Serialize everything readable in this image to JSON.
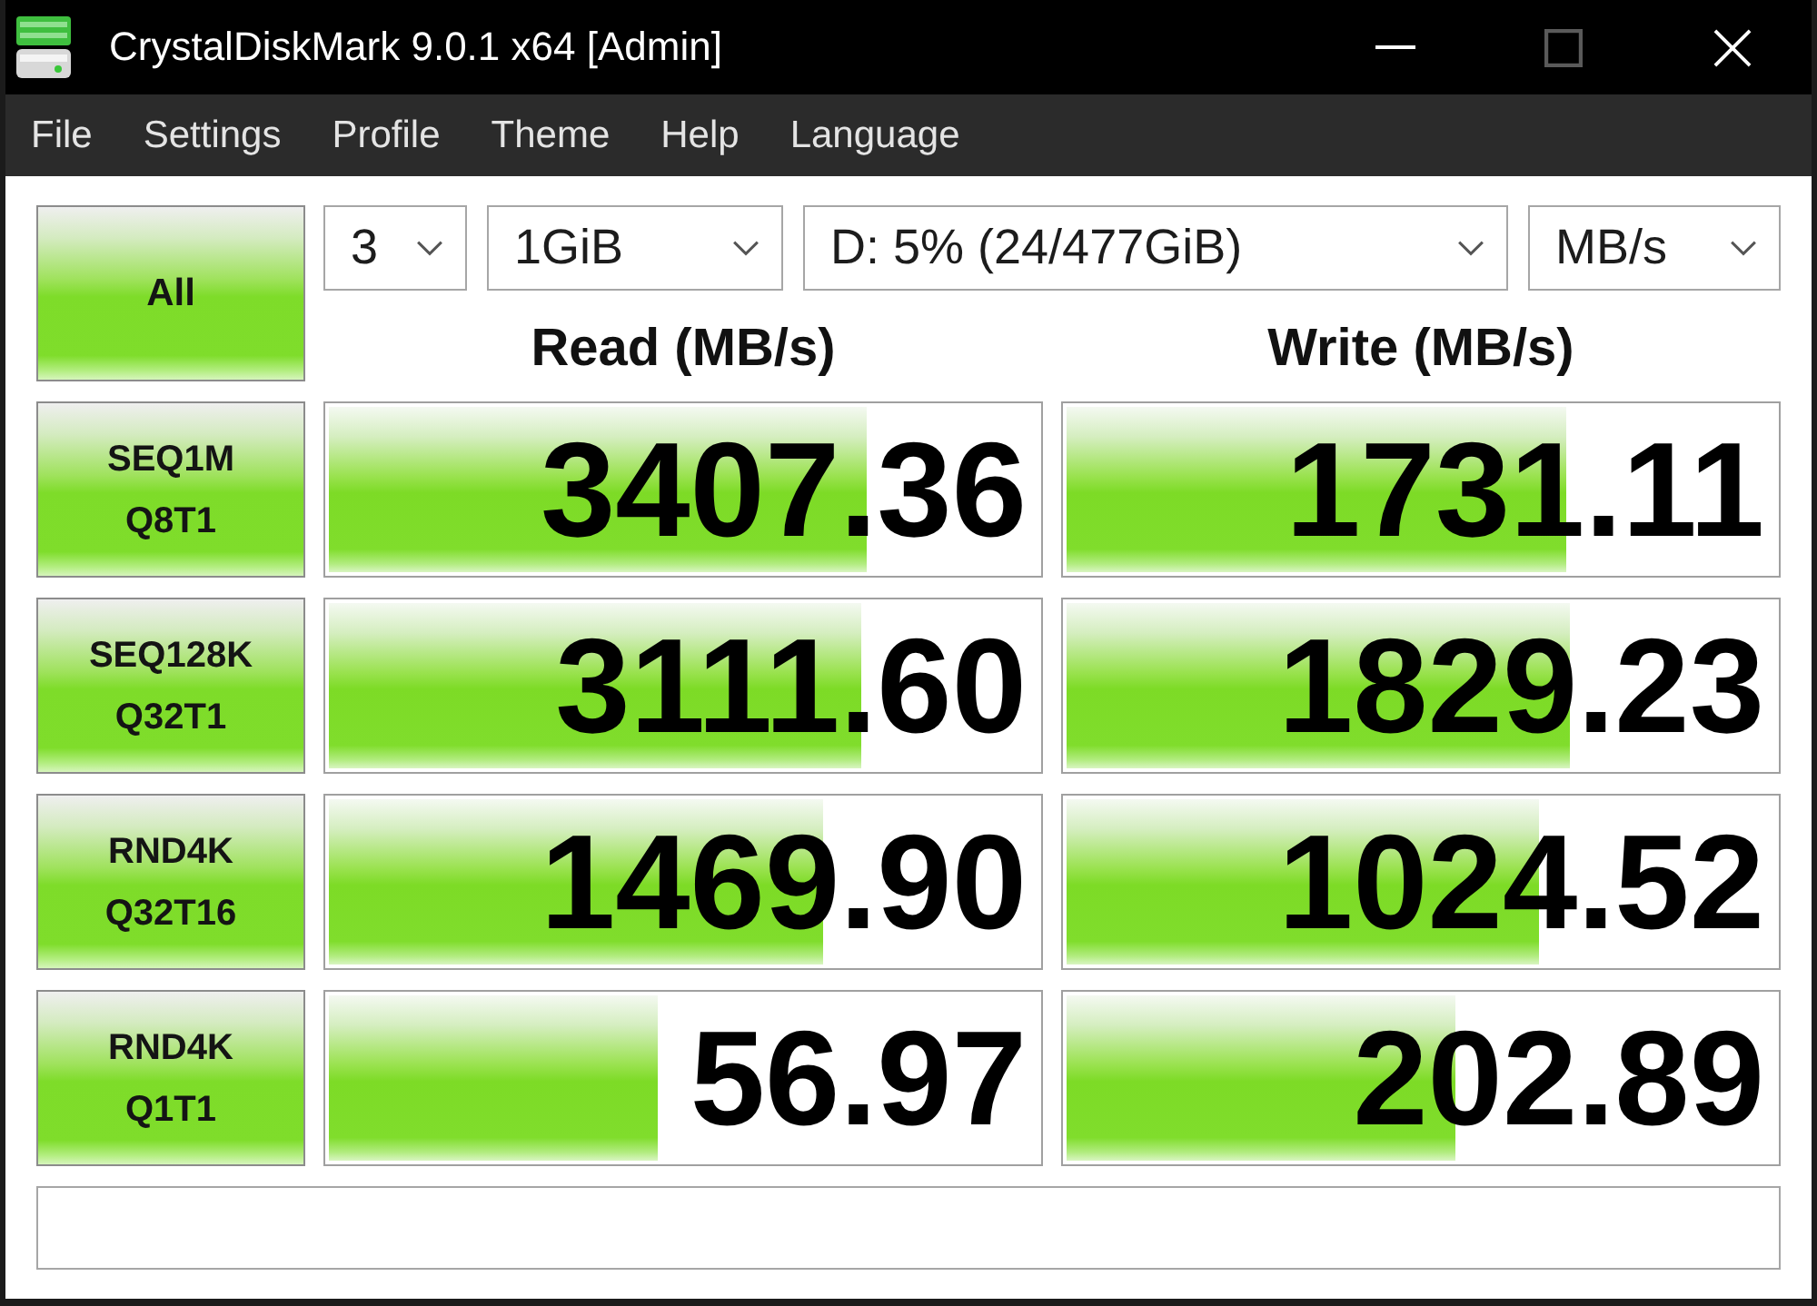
{
  "title_bar": {
    "title": "CrystalDiskMark 9.0.1 x64 [Admin]",
    "controls": [
      {
        "kind": "minimize",
        "disabled": false
      },
      {
        "kind": "maximize",
        "disabled": true
      },
      {
        "kind": "close",
        "disabled": false
      }
    ]
  },
  "menu": [
    "File",
    "Settings",
    "Profile",
    "Theme",
    "Help",
    "Language"
  ],
  "all_button": "All",
  "selectors": [
    {
      "value": "3"
    },
    {
      "value": "1GiB"
    },
    {
      "value": "D: 5% (24/477GiB)"
    },
    {
      "value": "MB/s"
    }
  ],
  "headers": {
    "read": "Read (MB/s)",
    "write": "Write (MB/s)"
  },
  "tests": [
    {
      "label": "SEQ1M",
      "sublabel": "Q8T1",
      "read": {
        "value": "3407.36",
        "level": 0.76
      },
      "write": {
        "value": "1731.11",
        "level": 0.705
      }
    },
    {
      "label": "SEQ128K",
      "sublabel": "Q32T1",
      "read": {
        "value": "3111.60",
        "level": 0.75
      },
      "write": {
        "value": "1829.23",
        "level": 0.71
      }
    },
    {
      "label": "RND4K",
      "sublabel": "Q32T16",
      "read": {
        "value": "1469.90",
        "level": 0.697
      },
      "write": {
        "value": "1024.52",
        "level": 0.667
      }
    },
    {
      "label": "RND4K",
      "sublabel": "Q1T1",
      "read": {
        "value": "56.97",
        "level": 0.463
      },
      "write": {
        "value": "202.89",
        "level": 0.548
      }
    }
  ]
}
